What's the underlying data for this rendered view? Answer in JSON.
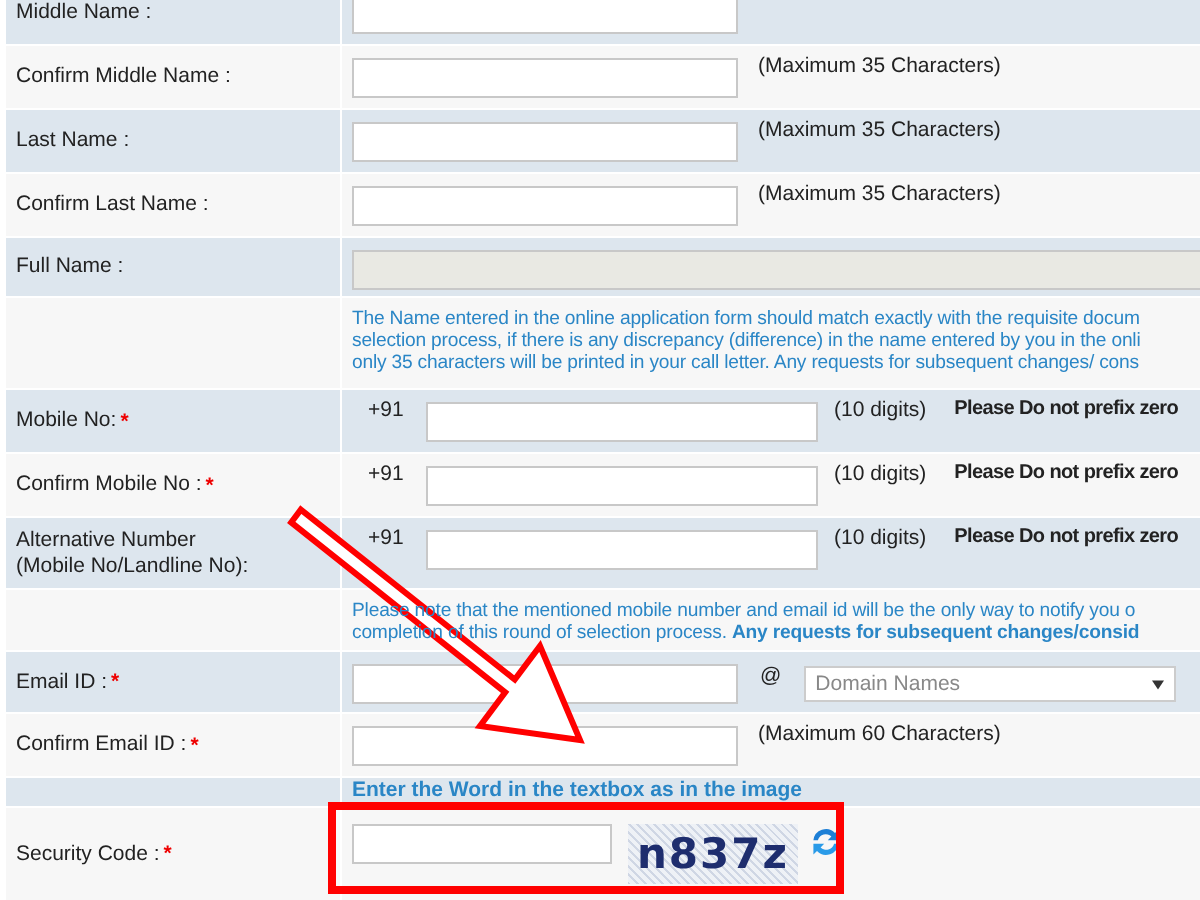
{
  "rows": [
    {
      "kind": "text",
      "label": "Middle Name :"
    },
    {
      "kind": "text",
      "label": "Confirm Middle Name :",
      "note": "(Maximum 35 Characters)"
    },
    {
      "kind": "text",
      "label": "Last Name :",
      "note": "(Maximum 35 Characters)"
    },
    {
      "kind": "text",
      "label": "Confirm Last Name :",
      "note": "(Maximum 35 Characters)"
    },
    {
      "kind": "readonly",
      "label": "Full Name :"
    },
    {
      "kind": "note",
      "lines": [
        "The Name entered in the online application form should match exactly with the requisite docum",
        "selection process, if there is any discrepancy (difference) in the name entered by you in the onli",
        "only 35 characters will be printed in your call letter. Any requests for subsequent changes/ cons"
      ]
    },
    {
      "kind": "phone",
      "label": "Mobile No:",
      "mark": "*",
      "prefix": "+91",
      "hint": "(10 digits)",
      "warning": "Please Do not prefix zero"
    },
    {
      "kind": "phone",
      "label": "Confirm Mobile No :",
      "mark": "*",
      "prefix": "+91",
      "hint": "(10 digits)",
      "warning": "Please Do not prefix zero"
    },
    {
      "kind": "phone",
      "label": "Alternative Number\n(Mobile No/Landline No):",
      "prefix": "+91",
      "hint": "(10 digits)",
      "warning": "Please Do not prefix zero"
    },
    {
      "kind": "note",
      "lines": [
        "Please note that the mentioned mobile number and email id will be the only way to notify you o",
        "completion of this round of selection process. **Any requests for subsequent changes/consid**"
      ]
    },
    {
      "kind": "email",
      "label": "Email ID :",
      "mark": "*",
      "at": "@",
      "select_placeholder": "Domain Names"
    },
    {
      "kind": "text",
      "label": "Confirm Email ID :",
      "mark": "*",
      "note": "(Maximum 60 Characters)"
    },
    {
      "kind": "heading",
      "text": "Enter the Word in the textbox as in the image"
    },
    {
      "kind": "captcha",
      "label": "Security Code :",
      "mark": "*",
      "code": "n837z"
    }
  ]
}
